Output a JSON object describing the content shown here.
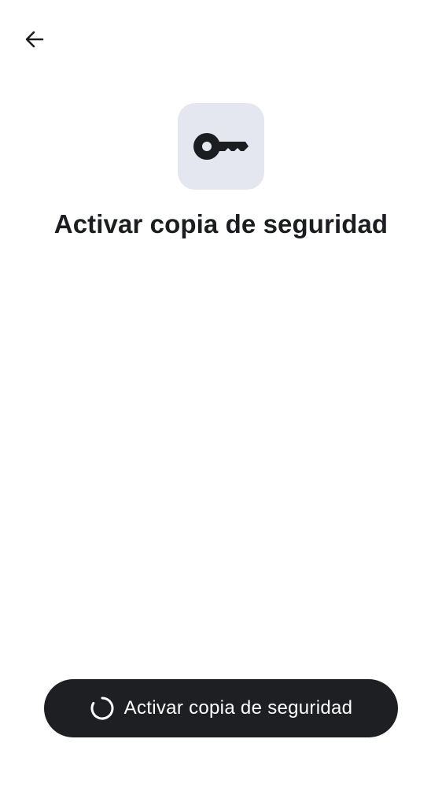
{
  "header": {
    "back_icon": "arrow-left-icon"
  },
  "hero": {
    "icon": "key-icon",
    "tile_color": "#e4e7f0"
  },
  "title": "Activar copia de seguridad",
  "primary_action": {
    "label": "Activar copia de seguridad",
    "loading_icon": "spinner-icon",
    "background": "#1e1f23"
  }
}
